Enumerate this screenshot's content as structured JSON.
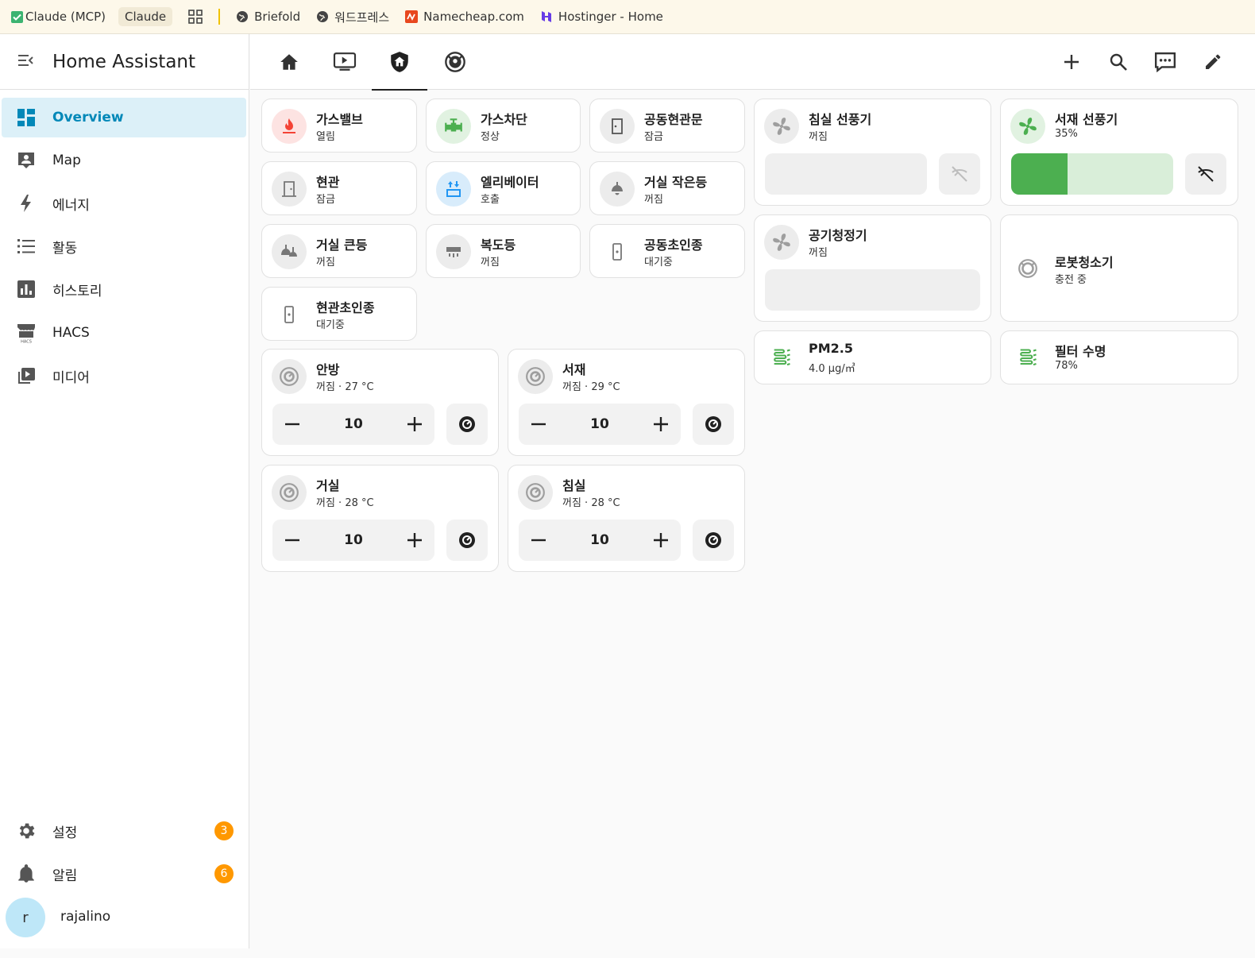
{
  "bookmarks": {
    "items": [
      {
        "label": "Claude (MCP)"
      },
      {
        "label": "Claude"
      },
      {
        "label": "Briefold"
      },
      {
        "label": "워드프레스"
      },
      {
        "label": "Namecheap.com"
      },
      {
        "label": "Hostinger - Home"
      }
    ]
  },
  "sidebar": {
    "title": "Home Assistant",
    "items": [
      {
        "label": "Overview",
        "icon": "dashboard-icon"
      },
      {
        "label": "Map",
        "icon": "map-account-icon"
      },
      {
        "label": "에너지",
        "icon": "lightning-bolt-icon"
      },
      {
        "label": "활동",
        "icon": "format-list-bulleted-icon"
      },
      {
        "label": "히스토리",
        "icon": "chart-box-icon"
      },
      {
        "label": "HACS",
        "icon": "hacs-icon"
      },
      {
        "label": "미디어",
        "icon": "play-box-multiple-icon"
      }
    ],
    "settings": {
      "label": "설정",
      "badge": "3"
    },
    "notifications": {
      "label": "알림",
      "badge": "6"
    },
    "user": {
      "initial": "r",
      "name": "rajalino"
    }
  },
  "tiles": {
    "gas_valve": {
      "name": "가스밸브",
      "state": "열림"
    },
    "gas_cutoff": {
      "name": "가스차단",
      "state": "정상"
    },
    "common_entrance": {
      "name": "공동현관문",
      "state": "잠금"
    },
    "front_door": {
      "name": "현관",
      "state": "잠금"
    },
    "elevator": {
      "name": "엘리베이터",
      "state": "호출"
    },
    "living_small_light": {
      "name": "거실 작은등",
      "state": "꺼짐"
    },
    "living_big_light": {
      "name": "거실 큰등",
      "state": "꺼짐"
    },
    "hallway_light": {
      "name": "복도등",
      "state": "꺼짐"
    },
    "common_doorbell": {
      "name": "공동초인종",
      "state": "대기중"
    },
    "front_doorbell": {
      "name": "현관초인종",
      "state": "대기중"
    },
    "bedroom_fan": {
      "name": "침실 선풍기",
      "state": "꺼짐"
    },
    "study_fan": {
      "name": "서재 선풍기",
      "state": "35%",
      "percentage": 35
    },
    "air_purifier": {
      "name": "공기청정기",
      "state": "꺼짐"
    },
    "robot_vacuum": {
      "name": "로봇청소기",
      "state": "충전 중"
    },
    "pm25": {
      "name": "PM2.5",
      "state": "4.0 µg/㎥"
    },
    "filter_life": {
      "name": "필터 수명",
      "state": "78%"
    }
  },
  "thermostats": [
    {
      "name": "안방",
      "state": "꺼짐 · 27 °C",
      "value": "10"
    },
    {
      "name": "서재",
      "state": "꺼짐 · 29 °C",
      "value": "10"
    },
    {
      "name": "거실",
      "state": "꺼짐 · 28 °C",
      "value": "10"
    },
    {
      "name": "침실",
      "state": "꺼짐 · 28 °C",
      "value": "10"
    }
  ],
  "colors": {
    "accent": "#0288b8",
    "active_green": "#4caf50",
    "gas_red": "#f44336",
    "badge_orange": "#ff9800",
    "elevator_blue": "#2196f3"
  }
}
